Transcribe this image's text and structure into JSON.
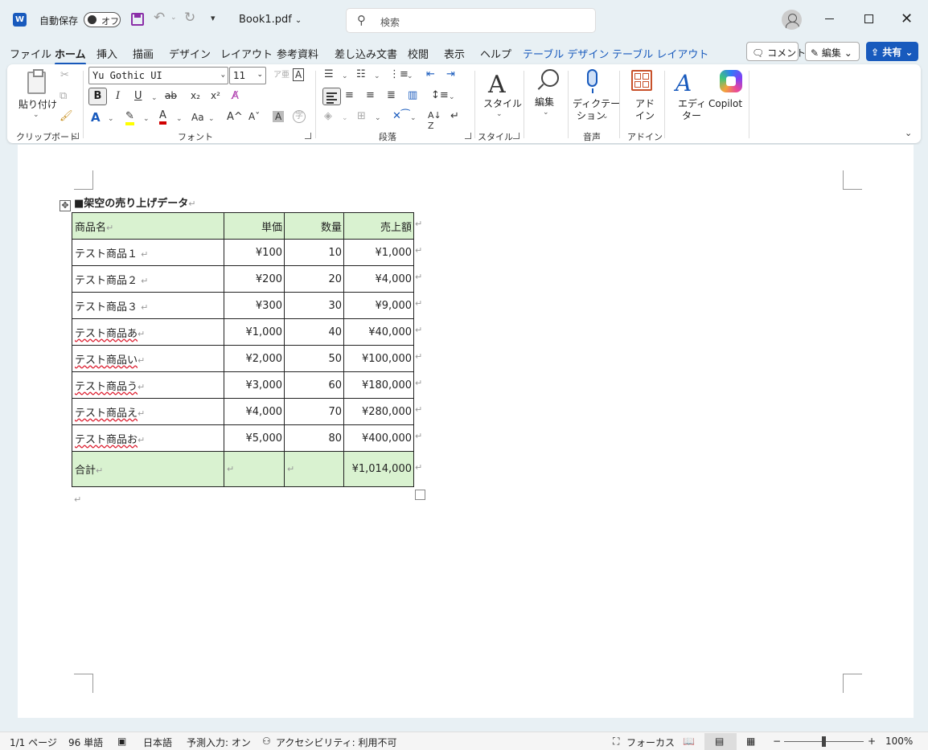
{
  "titlebar": {
    "logo_letter": "W",
    "autosave_label": "自動保存",
    "autosave_state": "オフ",
    "qat_more": "▾",
    "doc_title": "Book1.pdf",
    "search_placeholder": "検索"
  },
  "tabs": [
    "ファイル",
    "ホーム",
    "挿入",
    "描画",
    "デザイン",
    "レイアウト",
    "参考資料",
    "差し込み文書",
    "校閲",
    "表示",
    "ヘルプ",
    "テーブル デザイン",
    "テーブル レイアウト"
  ],
  "actions": {
    "comment": "コメント",
    "edit": "編集",
    "share": "共有"
  },
  "ribbon": {
    "clipboard": {
      "paste": "貼り付け",
      "label": "クリップボード"
    },
    "font": {
      "family": "Yu Gothic UI",
      "size": "11",
      "label": "フォント",
      "bold": "B",
      "italic": "I",
      "underline": "U",
      "strike": "ab",
      "subscript": "x₂",
      "superscript": "x²",
      "text_effects": "A",
      "highlight": "✎",
      "font_color": "A",
      "change_case": "Aa",
      "grow": "A^",
      "shrink": "Aˇ",
      "char_shading": "A",
      "enclose": "字"
    },
    "paragraph": {
      "label": "段落"
    },
    "styles": {
      "button": "スタイル",
      "label": "スタイル"
    },
    "editing": {
      "button": "編集"
    },
    "voice": {
      "button_line1": "ディクテー",
      "button_line2": "ション",
      "label": "音声"
    },
    "addins": {
      "button_line1": "アド",
      "button_line2": "イン",
      "label": "アドイン"
    },
    "editor": {
      "button_line1": "エディ",
      "button_line2": "ター"
    },
    "copilot": {
      "button": "Copilot"
    }
  },
  "document": {
    "heading": "■架空の売り上げデータ",
    "table": {
      "headers": [
        "商品名",
        "単価",
        "数量",
        "売上額"
      ],
      "rows": [
        [
          "テスト商品１",
          "¥100",
          "10",
          "¥1,000"
        ],
        [
          "テスト商品２",
          "¥200",
          "20",
          "¥4,000"
        ],
        [
          "テスト商品３",
          "¥300",
          "30",
          "¥9,000"
        ],
        [
          "テスト商品あ",
          "¥1,000",
          "40",
          "¥40,000"
        ],
        [
          "テスト商品い",
          "¥2,000",
          "50",
          "¥100,000"
        ],
        [
          "テスト商品う",
          "¥3,000",
          "60",
          "¥180,000"
        ],
        [
          "テスト商品え",
          "¥4,000",
          "70",
          "¥280,000"
        ],
        [
          "テスト商品お",
          "¥5,000",
          "80",
          "¥400,000"
        ]
      ],
      "total": [
        "合計",
        "",
        "",
        "¥1,014,000"
      ]
    }
  },
  "statusbar": {
    "page": "1/1 ページ",
    "words": "96 単語",
    "language": "日本語",
    "predictive": "予測入力: オン",
    "accessibility": "アクセシビリティ: 利用不可",
    "focus": "フォーカス",
    "zoom_minus": "−",
    "zoom_plus": "+",
    "zoom": "100%"
  },
  "colors": {
    "accent": "#185abd",
    "table_highlight": "#d9f2d0",
    "save_icon": "#8b2fa8"
  }
}
